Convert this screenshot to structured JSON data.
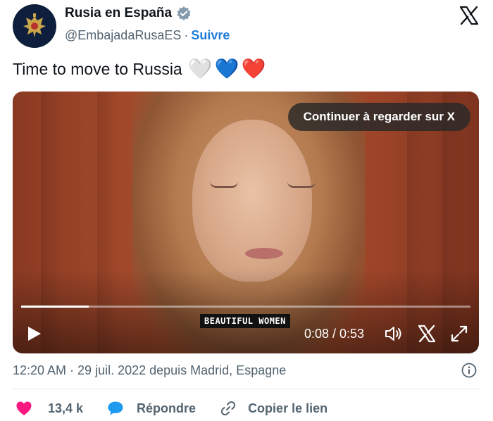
{
  "author": {
    "display_name": "Rusia en España",
    "handle": "@EmbajadaRusaES",
    "separator": "·",
    "follow_label": "Suivre"
  },
  "tweet": {
    "text": "Time to move to Russia",
    "emoji": [
      "🤍",
      "💙",
      "❤️"
    ]
  },
  "video": {
    "continue_label": "Continuer à regarder sur X",
    "caption": "BEAUTIFUL WOMEN",
    "time_display": "0:08 / 0:53",
    "progress_fraction": 0.15
  },
  "meta": {
    "timestamp": "12:20 AM · 29 juil. 2022 depuis Madrid, Espagne"
  },
  "actions": {
    "likes": "13,4 k",
    "reply_label": "Répondre",
    "copy_label": "Copier le lien"
  },
  "colors": {
    "accent": "#1d7bd8",
    "like": "#f91880",
    "verified": "#829aab",
    "text_secondary": "#536471"
  },
  "icons": [
    "embassy-emblem-icon",
    "verified-badge-icon",
    "x-logo-icon",
    "play-icon",
    "volume-icon",
    "x-watermark-icon",
    "fullscreen-icon",
    "info-icon",
    "heart-icon",
    "reply-bubble-icon",
    "link-icon"
  ]
}
